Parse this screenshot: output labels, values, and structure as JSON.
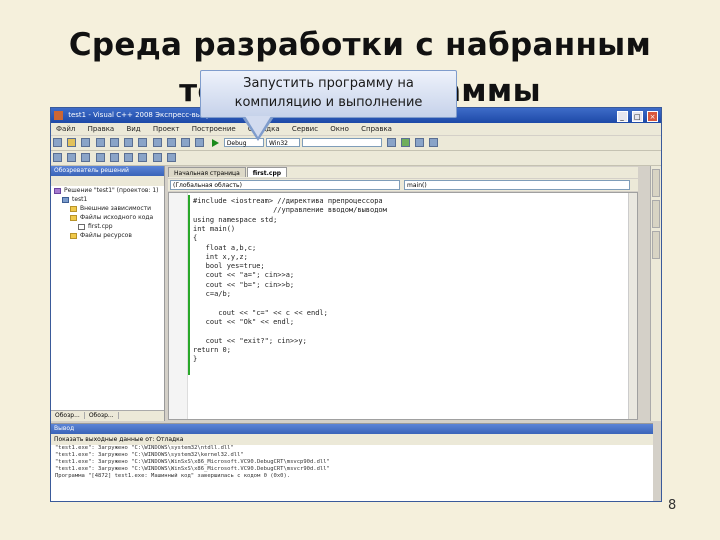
{
  "slide": {
    "title_line1": "Среда разработки с набранным",
    "title_line2": "текстом программы",
    "tooltip_line1": "Запустить программу на",
    "tooltip_line2": "компиляцию и выполнение",
    "page_number": "8"
  },
  "window": {
    "title": "test1 - Visual C++ 2008 Экспресс-выпуск",
    "menu": [
      "Файл",
      "Правка",
      "Вид",
      "Проект",
      "Построение",
      "Отладка",
      "Сервис",
      "Окно",
      "Справка"
    ],
    "toolbar_config": "Debug",
    "toolbar_platform": "Win32"
  },
  "solution_explorer": {
    "header": "Обозреватель решений",
    "items": [
      {
        "label": "Решение \"test1\" (проектов: 1)",
        "kind": "sol",
        "indent": 0
      },
      {
        "label": "test1",
        "kind": "proj",
        "indent": 1
      },
      {
        "label": "Внешние зависимости",
        "kind": "folder",
        "indent": 2
      },
      {
        "label": "Файлы исходного кода",
        "kind": "folder",
        "indent": 2
      },
      {
        "label": "first.cpp",
        "kind": "file",
        "indent": 3
      },
      {
        "label": "Файлы ресурсов",
        "kind": "folder",
        "indent": 2
      }
    ],
    "tabs": [
      "Обозр...",
      "Обозр..."
    ]
  },
  "editor": {
    "tabs": [
      "Начальная страница",
      "first.cpp"
    ],
    "scope_combo": "(Глобальная область)",
    "member_combo": "main()",
    "code_lines": [
      "#include <iostream> //директива препроцессора",
      "                   //управление вводом/выводом",
      "using namespace std;",
      "int main()",
      "{",
      "   float a,b,c;",
      "   int x,y,z;",
      "   bool yes=true;",
      "   cout << \"a=\"; cin>>a;",
      "   cout << \"b=\"; cin>>b;",
      "   c=a/b;",
      "",
      "      cout << \"c=\" << c << endl;",
      "   cout << \"Ok\" << endl;",
      "",
      "   cout << \"exit?\"; cin>>y;",
      "return 0;",
      "}"
    ]
  },
  "output": {
    "header": "Вывод",
    "source_label": "Показать выходные данные от: Отладка",
    "lines": [
      "\"test1.exe\": Загружено \"C:\\WINDOWS\\system32\\ntdll.dll\"",
      "\"test1.exe\": Загружено \"C:\\WINDOWS\\system32\\kernel32.dll\"",
      "\"test1.exe\": Загружено \"C:\\WINDOWS\\WinSxS\\x86_Microsoft.VC90.DebugCRT\\msvcp90d.dll\"",
      "\"test1.exe\": Загружено \"C:\\WINDOWS\\WinSxS\\x86_Microsoft.VC90.DebugCRT\\msvcr90d.dll\"",
      "Программа \"[4872] test1.exe: Машинный код\" завершилась с кодом 0 (0x0)."
    ]
  }
}
